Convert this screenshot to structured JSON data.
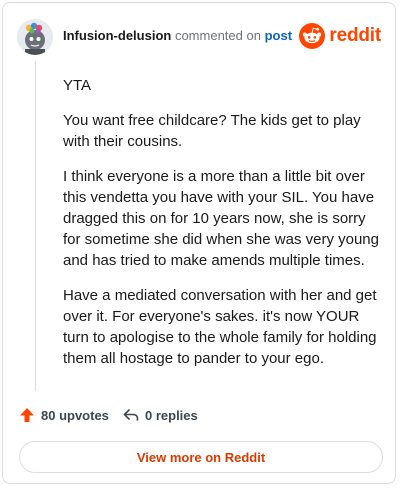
{
  "header": {
    "username": "Infusion-delusion",
    "action_text": "commented on",
    "post_link": "post",
    "brand": "reddit"
  },
  "comment": {
    "paragraphs": [
      "YTA",
      "You want free childcare? The kids get to play with their cousins.",
      "I think everyone is a more than a little bit over this vendetta you have with your SIL. You have dragged this on for 10 years now, she is sorry for sometime she did when she was very young and has tried to make amends multiple times.",
      "Have a mediated conversation with her and get over it. For everyone's sakes. it's now YOUR turn to apologise to the whole family for holding them all hostage to pander to your ego."
    ]
  },
  "footer": {
    "upvotes": "80 upvotes",
    "replies": "0 replies",
    "view_more": "View more on Reddit"
  },
  "colors": {
    "brand": "#ff4500",
    "link": "#0a66c2",
    "upvote": "#ff4500",
    "view_more": "#d93a00"
  },
  "icons": {
    "avatar": "avatar",
    "brand": "reddit-logo-icon",
    "upvote": "upvote-arrow-icon",
    "reply": "reply-arrow-icon"
  }
}
